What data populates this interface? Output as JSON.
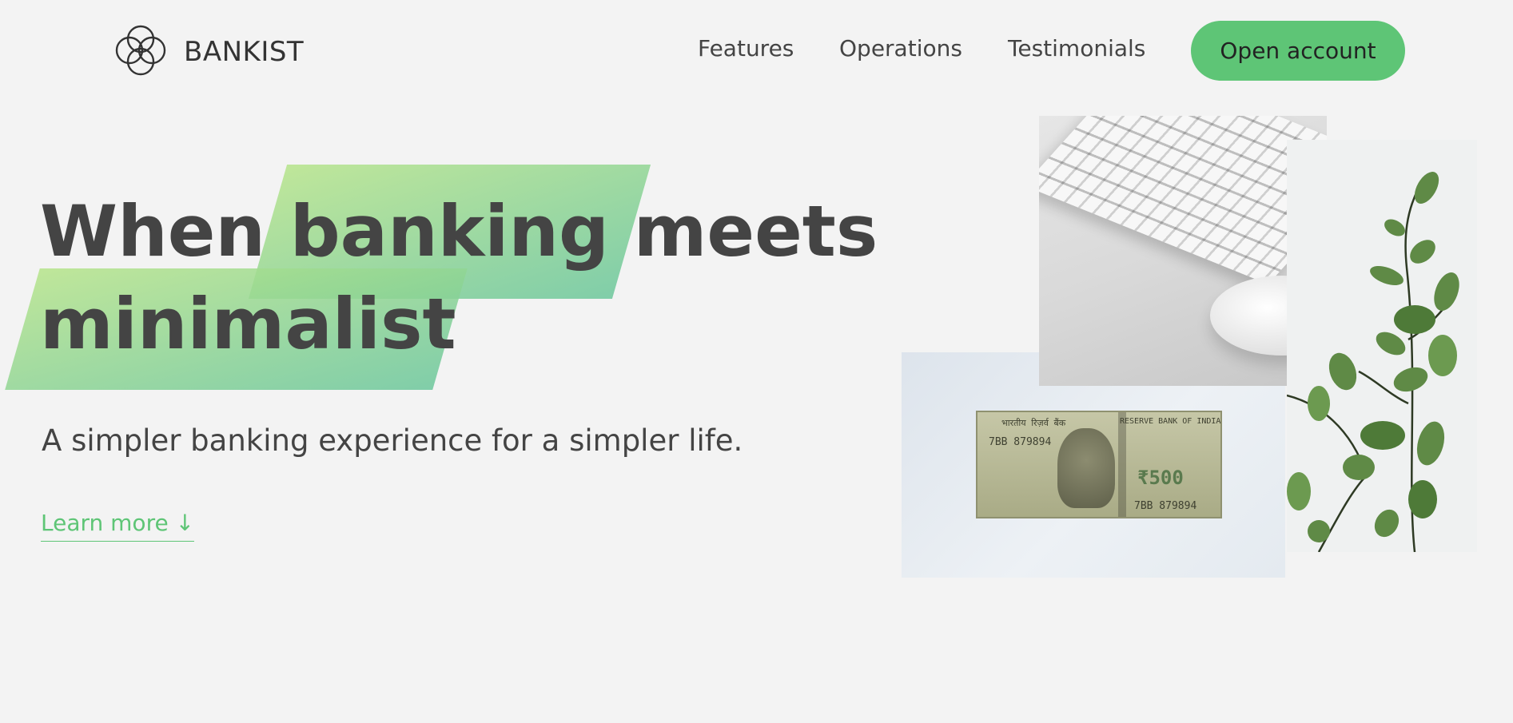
{
  "brand": {
    "name": "BANKIST",
    "accent": "#5ec576",
    "logo_icon": "four-circle-logo-icon"
  },
  "nav": {
    "links": [
      "Features",
      "Operations",
      "Testimonials"
    ],
    "cta_label": "Open account"
  },
  "hero": {
    "title_word_1": "When",
    "title_highlight_1": "banking",
    "title_word_2": "meets",
    "title_highlight_2": "minimalist",
    "subtitle": "A simpler banking experience for a simpler life.",
    "learn_more": "Learn more ↓"
  },
  "images": {
    "keyboard": "keyboard-and-mouse-image",
    "banknote": "banknote-image",
    "plant": "plant-image"
  },
  "banknote": {
    "header_left": "भारतीय रिज़र्व बैंक",
    "header_right": "RESERVE BANK OF INDIA",
    "serial": "7BB 879894",
    "denomination": "₹500"
  }
}
